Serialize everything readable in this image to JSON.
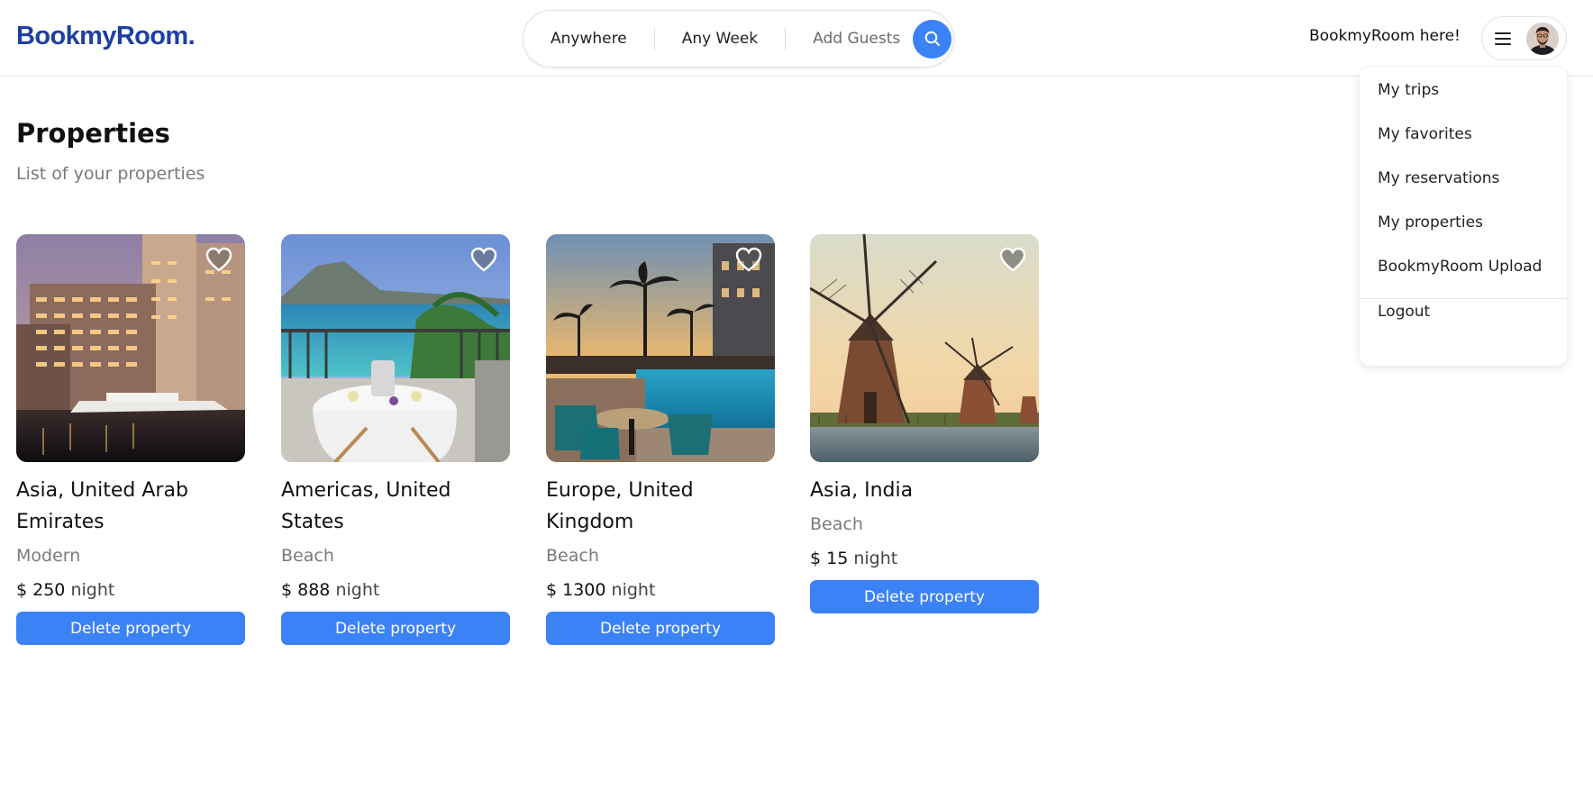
{
  "brand": {
    "logo_text": "BookmyRoom.",
    "logo_color": "#1e3fa3"
  },
  "search": {
    "location": "Anywhere",
    "dates": "Any Week",
    "guests": "Add Guests",
    "icon": "search-icon"
  },
  "header": {
    "host_link": "BookmyRoom here!",
    "menu_icon": "hamburger-icon",
    "avatar_icon": "user-avatar"
  },
  "user_menu": {
    "items": [
      "My trips",
      "My favorites",
      "My reservations",
      "My properties",
      "BookmyRoom Upload"
    ],
    "logout": "Logout"
  },
  "page": {
    "title": "Properties",
    "subtitle": "List of your properties"
  },
  "properties": [
    {
      "location": "Asia, United Arab Emirates",
      "category": "Modern",
      "price": "$ 250",
      "unit": "night",
      "action": "Delete property",
      "favorited": false
    },
    {
      "location": "Americas, United States",
      "category": "Beach",
      "price": "$ 888",
      "unit": "night",
      "action": "Delete property",
      "favorited": false
    },
    {
      "location": "Europe, United Kingdom",
      "category": "Beach",
      "price": "$ 1300",
      "unit": "night",
      "action": "Delete property",
      "favorited": false
    },
    {
      "location": "Asia, India",
      "category": "Beach",
      "price": "$ 15",
      "unit": "night",
      "action": "Delete property",
      "favorited": false
    }
  ],
  "colors": {
    "accent": "#3b82f6",
    "muted_text": "#7a7a7a"
  }
}
